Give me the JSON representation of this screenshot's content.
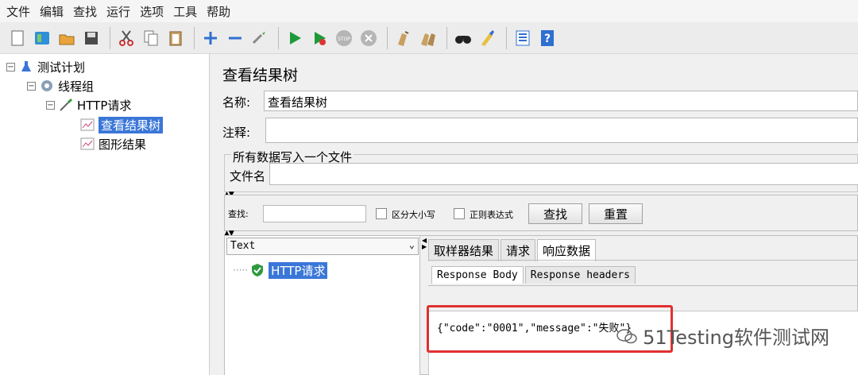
{
  "menu": [
    "文件",
    "编辑",
    "查找",
    "运行",
    "选项",
    "工具",
    "帮助"
  ],
  "toolbar_icons": [
    "new-icon",
    "templates-icon",
    "open-icon",
    "save-icon",
    "cut-icon",
    "copy-icon",
    "paste-icon",
    "expand-icon",
    "collapse-icon",
    "toggle-icon",
    "start-icon",
    "start-no-pause-icon",
    "stop-icon",
    "shutdown-icon",
    "clear-icon",
    "clear-all-icon",
    "search-icon",
    "reset-search-icon",
    "function-helper-icon",
    "help-icon"
  ],
  "tree": {
    "test_plan": "测试计划",
    "thread_group": "线程组",
    "http_request": "HTTP请求",
    "view_results_tree": "查看结果树",
    "graph_results": "图形结果"
  },
  "panel": {
    "title": "查看结果树",
    "name_label": "名称:",
    "name_value": "查看结果树",
    "comment_label": "注释:",
    "group_title": "所有数据写入一个文件",
    "filename_label": "文件名"
  },
  "search": {
    "label": "查找:",
    "case_sensitive": "区分大小写",
    "regex": "正则表达式",
    "find_button": "查找",
    "reset_button": "重置"
  },
  "results": {
    "renderer": "Text",
    "sample": "HTTP请求",
    "tabs": [
      "取样器结果",
      "请求",
      "响应数据"
    ],
    "active_tab": "响应数据",
    "subtabs": [
      "Response Body",
      "Response headers"
    ],
    "response_body": "{\"code\":\"0001\",\"message\":\"失败\"}"
  },
  "watermark": "51Testing软件测试网",
  "colors": {
    "selection": "#3a76d8",
    "highlight_box": "#e03030"
  }
}
